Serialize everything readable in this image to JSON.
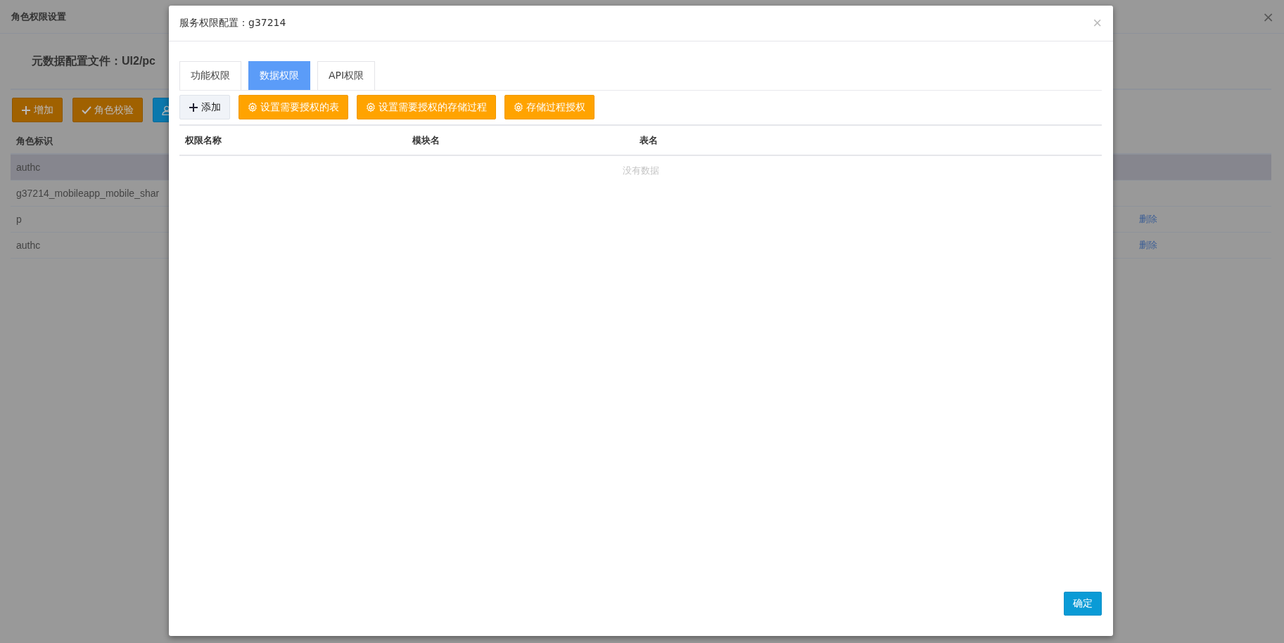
{
  "page": {
    "title": "角色权限设置",
    "config_label": "元数据配置文件：",
    "config_value": "UI2/pc",
    "close": "×",
    "buttons": [
      {
        "kind": "add",
        "label": "增加"
      },
      {
        "kind": "check",
        "label": "角色校验"
      },
      {
        "kind": "user"
      }
    ],
    "column": "角色标识",
    "rows": [
      {
        "role": "authc",
        "selected": true
      },
      {
        "role": "g37214_mobileapp_mobile_shar",
        "selected": false
      },
      {
        "role": "p",
        "selected": false,
        "action": "删除"
      },
      {
        "role": "authc",
        "selected": false,
        "action": "删除"
      }
    ]
  },
  "dialog": {
    "title": "服务权限配置：g37214",
    "tabs": [
      {
        "label": "功能权限",
        "selected": false
      },
      {
        "label": "数据权限",
        "selected": true
      },
      {
        "label": "API权限",
        "selected": false
      }
    ],
    "toolbar": [
      {
        "kind": "add",
        "label": "添加"
      },
      {
        "kind": "gear",
        "label": "设置需要授权的表"
      },
      {
        "kind": "gear",
        "label": "设置需要授权的存储过程"
      },
      {
        "kind": "gear",
        "label": "存储过程授权"
      }
    ],
    "columns": [
      "权限名称",
      "模块名",
      "表名"
    ],
    "empty_text": "没有数据",
    "confirm": "确定",
    "close": "×"
  }
}
